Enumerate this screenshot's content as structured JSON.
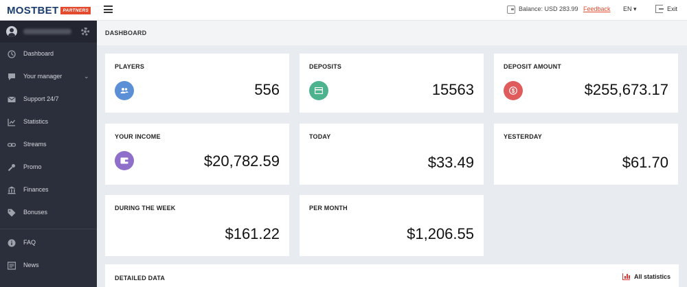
{
  "brand": {
    "name": "MOSTBET",
    "badge": "PARTNERS"
  },
  "topbar": {
    "balance": "Balance: USD 283.99",
    "feedback": "Feedback",
    "language": "EN ▾",
    "exit": "Exit"
  },
  "sidebar": {
    "items": [
      {
        "label": "Dashboard",
        "icon": "dashboard-icon"
      },
      {
        "label": "Your manager",
        "icon": "chat-icon"
      },
      {
        "label": "Support 24/7",
        "icon": "envelope-icon"
      },
      {
        "label": "Statistics",
        "icon": "chart-icon"
      },
      {
        "label": "Streams",
        "icon": "link-icon"
      },
      {
        "label": "Promo",
        "icon": "wrench-icon"
      },
      {
        "label": "Finances",
        "icon": "bank-icon"
      },
      {
        "label": "Bonuses",
        "icon": "tag-icon"
      },
      {
        "label": "FAQ",
        "icon": "info-icon"
      },
      {
        "label": "News",
        "icon": "news-icon"
      }
    ]
  },
  "breadcrumb": "DASHBOARD",
  "cards": {
    "players": {
      "title": "PLAYERS",
      "value": "556"
    },
    "deposits": {
      "title": "DEPOSITS",
      "value": "15563"
    },
    "deposit_amount": {
      "title": "DEPOSIT AMOUNT",
      "value": "$255,673.17"
    },
    "income": {
      "title": "YOUR INCOME",
      "value": "$20,782.59"
    },
    "today": {
      "title": "TODAY",
      "value": "$33.49"
    },
    "yesterday": {
      "title": "YESTERDAY",
      "value": "$61.70"
    },
    "week": {
      "title": "DURING THE WEEK",
      "value": "$161.22"
    },
    "month": {
      "title": "PER MONTH",
      "value": "$1,206.55"
    }
  },
  "detailed": {
    "title": "DETAILED DATA",
    "all_stats": "All statistics"
  },
  "colors": {
    "players": "#5b8fd6",
    "deposits": "#4db38e",
    "deposit_amount": "#e05c5c",
    "income": "#8e6fc9",
    "sidebar": "#2b2f3b",
    "accent": "#e34a2e"
  }
}
